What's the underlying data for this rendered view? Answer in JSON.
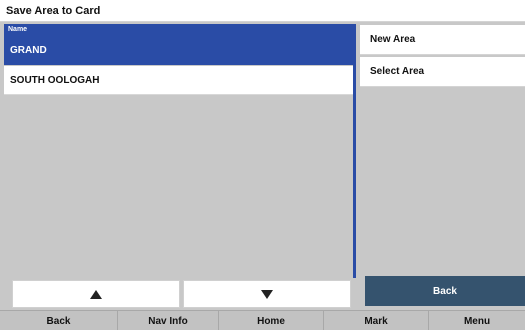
{
  "window": {
    "title": "Save Area to Card"
  },
  "list": {
    "header": "Name",
    "items": [
      {
        "label": "GRAND",
        "selected": true
      },
      {
        "label": "SOUTH OOLOGAH",
        "selected": false
      }
    ]
  },
  "side_menu": {
    "new_area": "New Area",
    "select_area": "Select Area",
    "back": "Back"
  },
  "scroll": {
    "up_icon": "triangle-up-icon",
    "down_icon": "triangle-down-icon"
  },
  "bottom_nav": {
    "items": [
      "Back",
      "Nav Info",
      "Home",
      "Mark",
      "Menu"
    ]
  },
  "colors": {
    "selected_bg": "#2a4ca6",
    "back_button_bg": "#35536e",
    "panel_bg": "#c8c8c8"
  }
}
